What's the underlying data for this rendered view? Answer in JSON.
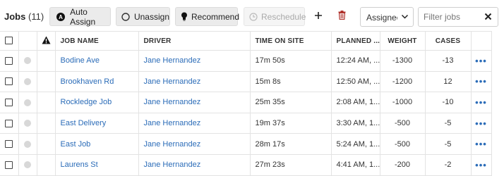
{
  "header": {
    "title": "Jobs",
    "count": "(11)"
  },
  "toolbar": {
    "auto_assign": "Auto Assign",
    "unassign": "Unassign",
    "recommend": "Recommend",
    "reschedule": "Reschedule",
    "assignee_select": "Assignee",
    "filter_placeholder": "Filter jobs"
  },
  "table": {
    "columns": {
      "job_name": "JOB NAME",
      "driver": "DRIVER",
      "time_on_site": "TIME ON SITE",
      "planned": "PLANNED ...",
      "weight": "WEIGHT",
      "cases": "CASES"
    },
    "rows": [
      {
        "job_name": "Bodine Ave",
        "driver": "Jane Hernandez",
        "time_on_site": "17m 50s",
        "planned": "12:24 AM, ...",
        "weight": "-1300",
        "cases": "-13",
        "more": "•••"
      },
      {
        "job_name": "Brookhaven Rd",
        "driver": "Jane Hernandez",
        "time_on_site": "15m 8s",
        "planned": "12:50 AM, ...",
        "weight": "-1200",
        "cases": "12",
        "more": "•••"
      },
      {
        "job_name": "Rockledge Job",
        "driver": "Jane Hernandez",
        "time_on_site": "25m 35s",
        "planned": "2:08 AM, 1...",
        "weight": "-1000",
        "cases": "-10",
        "more": "•••"
      },
      {
        "job_name": "East Delivery",
        "driver": "Jane Hernandez",
        "time_on_site": "19m 37s",
        "planned": "3:30 AM, 1...",
        "weight": "-500",
        "cases": "-5",
        "more": "•••"
      },
      {
        "job_name": "East Job",
        "driver": "Jane Hernandez",
        "time_on_site": "28m 17s",
        "planned": "5:24 AM, 1...",
        "weight": "-500",
        "cases": "-5",
        "more": "•••"
      },
      {
        "job_name": "Laurens St",
        "driver": "Jane Hernandez",
        "time_on_site": "27m 23s",
        "planned": "4:41 AM, 1...",
        "weight": "-200",
        "cases": "-2",
        "more": "•••"
      }
    ]
  },
  "icons": {
    "auto_assign": "auto-assign-icon",
    "unassign": "circle-icon",
    "recommend": "lightbulb-icon",
    "reschedule": "clock-icon",
    "add": "plus-icon",
    "delete": "trash-icon",
    "warning": "warning-icon",
    "status": "status-dot-icon",
    "clear": "close-icon",
    "dropdown": "chevron-down-icon"
  },
  "colors": {
    "link": "#2b6cb8",
    "delete_icon": "#b0332d",
    "button_bg": "#ebebeb",
    "status_dot": "#d8d8d8"
  }
}
